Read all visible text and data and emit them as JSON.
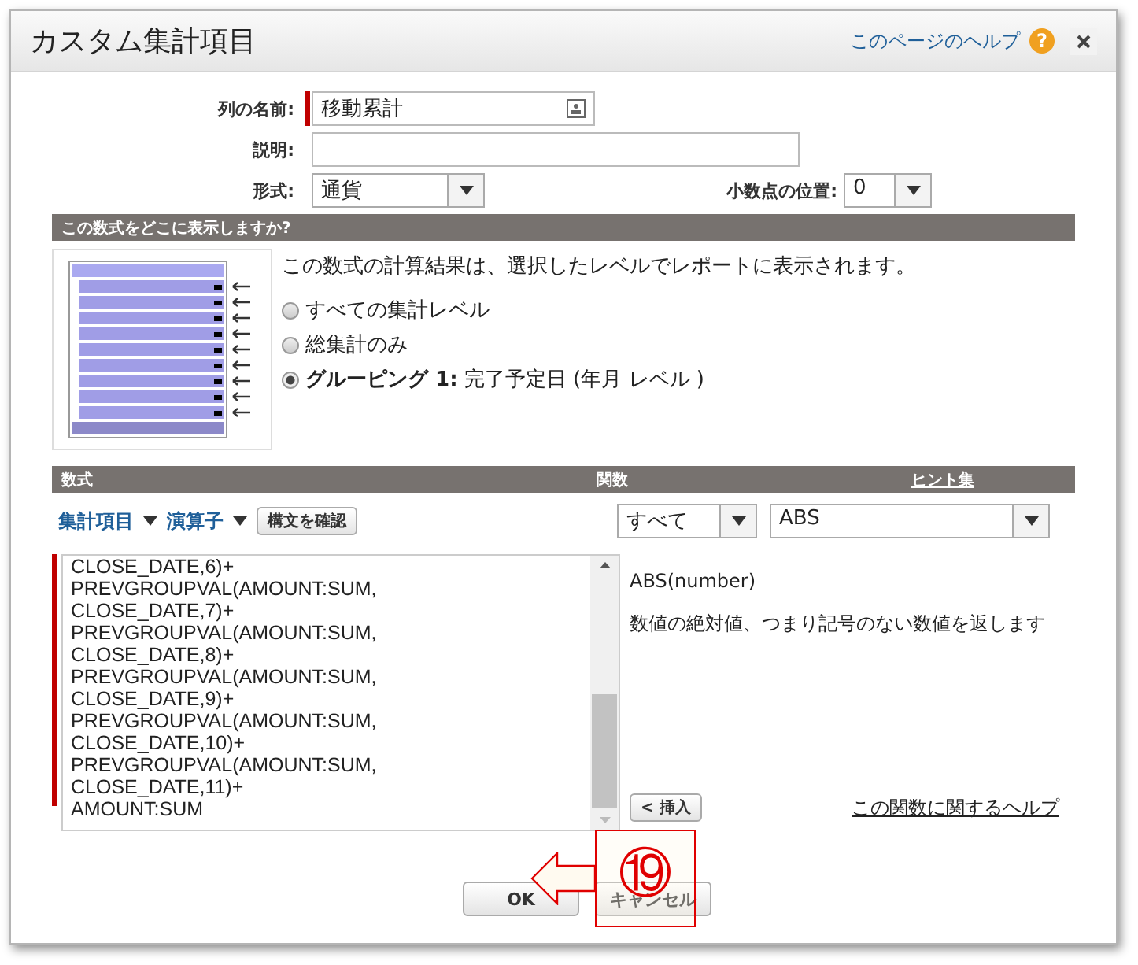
{
  "window": {
    "title": "カスタム集計項目",
    "help_link": "このページのヘルプ",
    "help_icon": "?"
  },
  "fields": [
    {
      "kind": "text",
      "label": "列の名前:",
      "value": "移動累計",
      "required": true
    },
    {
      "kind": "wide",
      "label": "説明:",
      "required": false
    },
    {
      "kind": "select",
      "label": "形式:",
      "value": "通貨",
      "required": false,
      "side_label": "小数点の位置:",
      "side_value": "0"
    }
  ],
  "display_section": {
    "title": "この数式をどこに表示しますか?",
    "description": "この数式の計算結果は、選択したレベルでレポートに表示されます。",
    "options": [
      {
        "label": "すべての集計レベル",
        "selected": false
      },
      {
        "label": "総集計のみ",
        "selected": false
      },
      {
        "label": "**グルーピング 1:** 完了予定日 (年月 レベル )",
        "selected": true
      }
    ]
  },
  "formula_section": {
    "headers": [
      "数式",
      "関数",
      "ヒント集"
    ],
    "menus": [
      "集計項目",
      "演算子"
    ],
    "check_button": "構文を確認",
    "category_select": "すべて",
    "function_select": "ABS",
    "formula": "CLOSE_DATE,6)+\nPREVGROUPVAL(AMOUNT:SUM,\nCLOSE_DATE,7)+\nPREVGROUPVAL(AMOUNT:SUM,\nCLOSE_DATE,8)+\nPREVGROUPVAL(AMOUNT:SUM,\nCLOSE_DATE,9)+\nPREVGROUPVAL(AMOUNT:SUM,\nCLOSE_DATE,10)+\nPREVGROUPVAL(AMOUNT:SUM,\nCLOSE_DATE,11)+\nAMOUNT:SUM",
    "function_signature": "ABS(number)",
    "function_description": "数値の絶対値、つまり記号のない数値を返します",
    "insert_button": "< 挿入",
    "function_help_link": "この関数に関するヘルプ"
  },
  "buttons": [
    "OK",
    "キャンセル"
  ],
  "annotation": {
    "number": "⑲"
  }
}
